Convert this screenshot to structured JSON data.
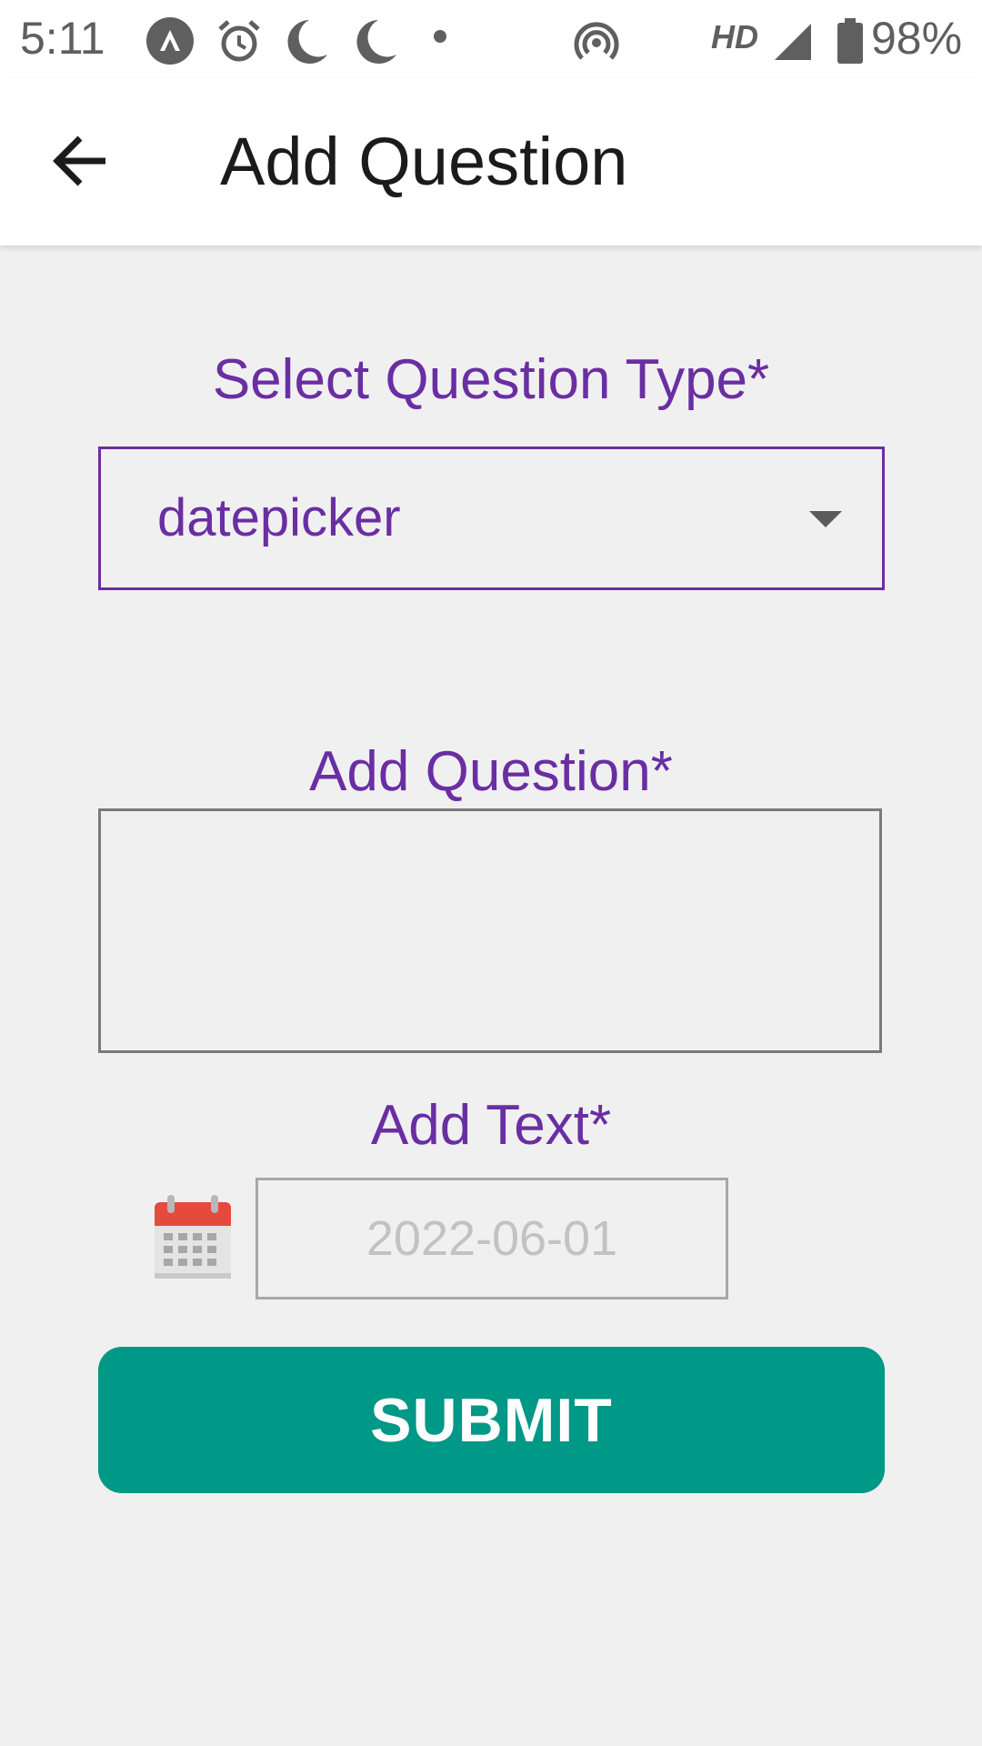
{
  "status_bar": {
    "time": "5:11",
    "network_label": "HD",
    "battery_percent": "98%",
    "icons": [
      "app-notification-icon",
      "alarm-icon",
      "moon-icon",
      "moon-icon",
      "dot-icon",
      "hotspot-icon",
      "signal-icon",
      "battery-icon"
    ]
  },
  "app_bar": {
    "title": "Add Question",
    "back_icon": "back-arrow-icon"
  },
  "form": {
    "question_type": {
      "label": "Select Question Type*",
      "selected_value": "datepicker"
    },
    "question": {
      "label": "Add Question*",
      "value": ""
    },
    "text": {
      "label": "Add Text*",
      "placeholder": "2022-06-01",
      "icon": "calendar-icon"
    },
    "submit_label": "SUBMIT"
  },
  "colors": {
    "accent": "#6a2ea3",
    "submit": "#009886",
    "background": "#f0f0f0"
  }
}
